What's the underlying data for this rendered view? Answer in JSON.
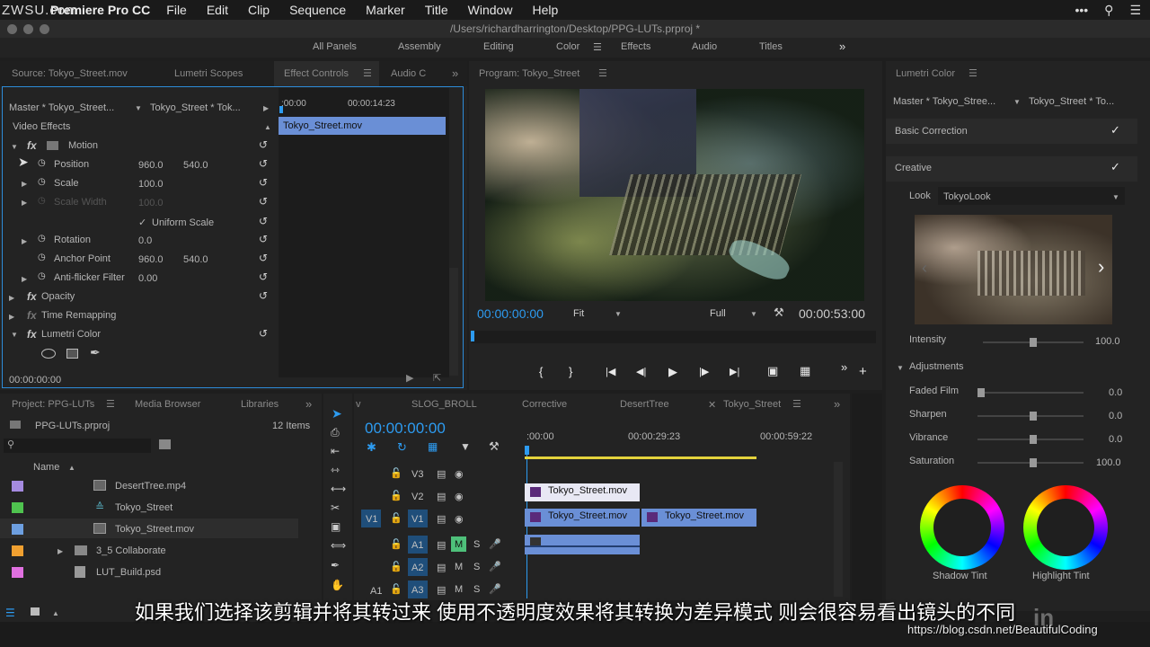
{
  "menubar": {
    "app_name": "Premiere Pro CC",
    "items": [
      "File",
      "Edit",
      "Clip",
      "Sequence",
      "Marker",
      "Title",
      "Window",
      "Help"
    ],
    "watermark": "ZWSU.com"
  },
  "window": {
    "title": "/Users/richardharrington/Desktop/PPG-LUTs.prproj *"
  },
  "workspaces": {
    "items": [
      "All Panels",
      "Assembly",
      "Editing",
      "Color",
      "Effects",
      "Audio",
      "Titles"
    ],
    "active": "Color",
    "overflow": "»"
  },
  "effect_controls": {
    "tabs": [
      "Source: Tokyo_Street.mov",
      "Lumetri Scopes",
      "Effect Controls",
      "Audio C"
    ],
    "master": "Master * Tokyo_Street...",
    "sequence_clip": "Tokyo_Street * Tok...",
    "ruler_start": ":00:00",
    "ruler_mid": "00:00:14:23",
    "clip_name": "Tokyo_Street.mov",
    "section": "Video Effects",
    "motion": "Motion",
    "position_label": "Position",
    "position_x": "960.0",
    "position_y": "540.0",
    "scale_label": "Scale",
    "scale_value": "100.0",
    "scale_width_label": "Scale Width",
    "scale_width_value": "100.0",
    "uniform_scale": "Uniform Scale",
    "rotation_label": "Rotation",
    "rotation_value": "0.0",
    "anchor_label": "Anchor Point",
    "anchor_x": "960.0",
    "anchor_y": "540.0",
    "antiflicker_label": "Anti-flicker Filter",
    "antiflicker_value": "0.00",
    "opacity": "Opacity",
    "time_remapping": "Time Remapping",
    "lumetri": "Lumetri Color",
    "timecode": "00:00:00:00"
  },
  "program": {
    "title": "Program: Tokyo_Street",
    "timecode": "00:00:00:00",
    "fit": "Fit",
    "quality": "Full",
    "duration": "00:00:53:00",
    "transport": [
      "{",
      "}",
      "|◀",
      "◀|",
      "▶",
      "|▶",
      "▶|"
    ]
  },
  "lumetri_color": {
    "title": "Lumetri Color",
    "master": "Master * Tokyo_Stree...",
    "clip": "Tokyo_Street * To...",
    "basic_correction": "Basic Correction",
    "creative": "Creative",
    "look_label": "Look",
    "look_value": "TokyoLook",
    "intensity_label": "Intensity",
    "intensity_value": "100.0",
    "intensity_level": 0.5,
    "adjustments": "Adjustments",
    "faded_film_label": "Faded Film",
    "faded_film_value": "0.0",
    "sharpen_label": "Sharpen",
    "sharpen_value": "0.0",
    "vibrance_label": "Vibrance",
    "vibrance_value": "0.0",
    "saturation_label": "Saturation",
    "saturation_value": "100.0",
    "shadow_tint": "Shadow Tint",
    "highlight_tint": "Highlight Tint"
  },
  "project": {
    "tabs": [
      "Project: PPG-LUTs",
      "Media Browser",
      "Libraries"
    ],
    "file": "PPG-LUTs.prproj",
    "count": "12 Items",
    "column_name": "Name",
    "items": [
      {
        "name": "DesertTree.mp4",
        "color": "#a58ae0"
      },
      {
        "name": "Tokyo_Street",
        "color": "#4fc34f"
      },
      {
        "name": "Tokyo_Street.mov",
        "color": "#6d9fe0"
      },
      {
        "name": "3_5 Collaborate",
        "color": "#f0a030"
      },
      {
        "name": "LUT_Build.psd",
        "color": "#e070e0"
      }
    ]
  },
  "timeline": {
    "tabs": [
      "SLOG_BROLL",
      "Corrective",
      "DesertTree",
      "Tokyo_Street"
    ],
    "timecode": "00:00:00:00",
    "ruler": [
      ":00:00",
      "00:00:29:23",
      "00:00:59:22"
    ],
    "tracks": [
      "V3",
      "V2",
      "V1",
      "A1",
      "A2",
      "A3"
    ],
    "source_v": "V1",
    "source_a": "A1",
    "clip_v2": "Tokyo_Street.mov",
    "clip_v1a": "Tokyo_Street.mov",
    "clip_v1b": "Tokyo_Street.mov",
    "m": "M",
    "s": "S"
  },
  "subtitle": "如果我们选择该剪辑并将其转过来  使用不透明度效果将其转换为差异模式  则会很容易看出镜头的不同",
  "watermark_bottom": "https://blog.csdn.net/BeautifulCoding"
}
